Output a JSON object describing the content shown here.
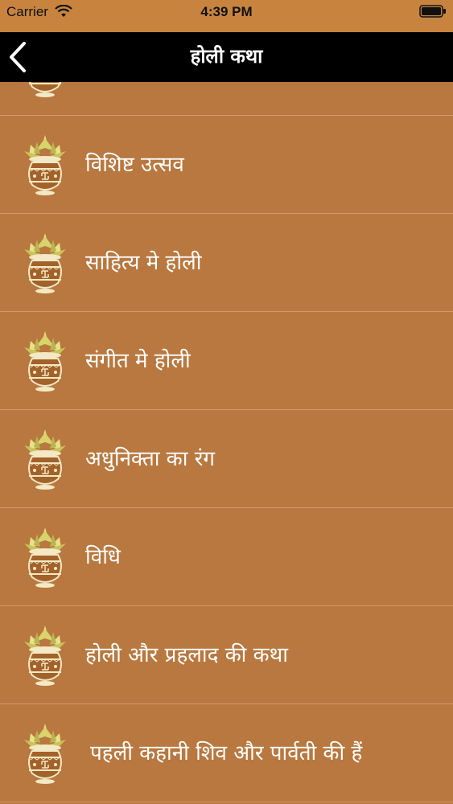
{
  "status_bar": {
    "carrier": "Carrier",
    "time": "4:39 PM"
  },
  "nav": {
    "title": "होली कथा"
  },
  "colors": {
    "background": "#b8783f",
    "nav_bar": "#000000",
    "separator": "#d39b63",
    "text": "#ffffff"
  },
  "list": {
    "items": [
      {
        "label": "विशिष्ट उत्सव",
        "icon": "kalash-icon"
      },
      {
        "label": "साहित्य मे होली",
        "icon": "kalash-icon"
      },
      {
        "label": "संगीत मे होली",
        "icon": "kalash-icon"
      },
      {
        "label": "अधुनिक्ता का रंग",
        "icon": "kalash-icon"
      },
      {
        "label": "विधि",
        "icon": "kalash-icon"
      },
      {
        "label": "होली और प्रहलाद की कथा",
        "icon": "kalash-icon"
      },
      {
        "label": "पहली कहानी शिव और पार्वती की हैं",
        "icon": "kalash-icon"
      }
    ]
  }
}
